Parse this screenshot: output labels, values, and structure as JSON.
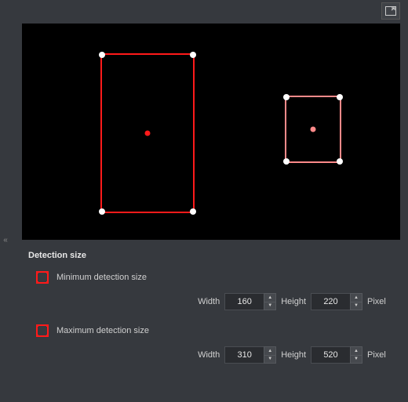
{
  "sidebar": {
    "collapse_glyph": "«"
  },
  "section": {
    "title": "Detection size"
  },
  "min_detection": {
    "label": "Minimum detection size",
    "width_label": "Width",
    "width_value": "160",
    "height_label": "Height",
    "height_value": "220",
    "unit": "Pixel"
  },
  "max_detection": {
    "label": "Maximum detection size",
    "width_label": "Width",
    "width_value": "310",
    "height_label": "Height",
    "height_value": "520",
    "unit": "Pixel"
  },
  "colors": {
    "min_rect": "#ff1a1a",
    "max_rect": "#ff8a8a"
  }
}
